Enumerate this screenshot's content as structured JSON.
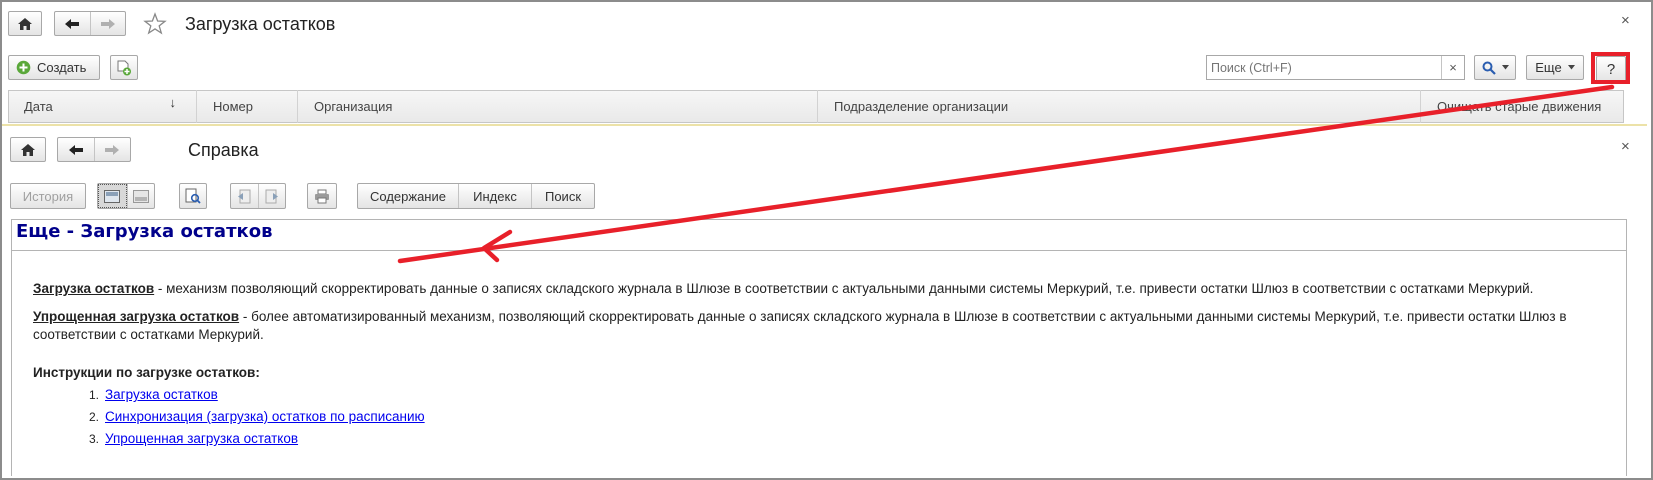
{
  "top_window": {
    "title": "Загрузка остатков",
    "close_glyph": "×",
    "toolbar": {
      "create_label": "Создать",
      "search_placeholder": "Поиск (Ctrl+F)",
      "search_clear_glyph": "×",
      "more_label": "Еще",
      "help_label": "?"
    },
    "columns": [
      "Дата",
      "Номер",
      "Организация",
      "Подразделение организации",
      "Очищать старые движения"
    ],
    "sort_glyph": "↓"
  },
  "help_window": {
    "title": "Справка",
    "close_glyph": "×",
    "toolbar": {
      "history_label": "История",
      "tabs": [
        "Содержание",
        "Индекс",
        "Поиск"
      ]
    },
    "heading": "Еще - Загрузка остатков",
    "paragraphs": [
      {
        "term": "Загрузка остатков",
        "text": " - механизм позволяющий скорректировать данные о записях складского журнала в Шлюзе в соответствии с актуальными данными системы Меркурий, т.е. привести остатки Шлюз в соответствии с остатками Меркурий."
      },
      {
        "term": "Упрощенная загрузка остатков",
        "text": " - более автоматизированный механизм, позволяющий скорректировать данные о записях складского журнала в Шлюзе в соответствии с актуальными данными системы Меркурий, т.е. привести остатки Шлюз в соответствии с остатками Меркурий."
      }
    ],
    "instructions_heading": "Инструкции по загрузке остатков:",
    "instructions": [
      {
        "num": "1.",
        "label": "Загрузка остатков"
      },
      {
        "num": "2.",
        "label": "Синхронизация (загрузка) остатков по расписанию"
      },
      {
        "num": "3.",
        "label": "Упрощенная загрузка остатков"
      }
    ]
  },
  "annotation": {
    "highlight_color": "#e8202a",
    "arrow_color": "#e8202a"
  },
  "icons": {
    "home": "home-icon",
    "back": "arrow-left-icon",
    "forward": "arrow-right-icon",
    "star": "star-icon",
    "create": "plus-circle-icon",
    "copy": "add-document-icon",
    "search": "magnifier-icon",
    "print": "printer-icon"
  }
}
